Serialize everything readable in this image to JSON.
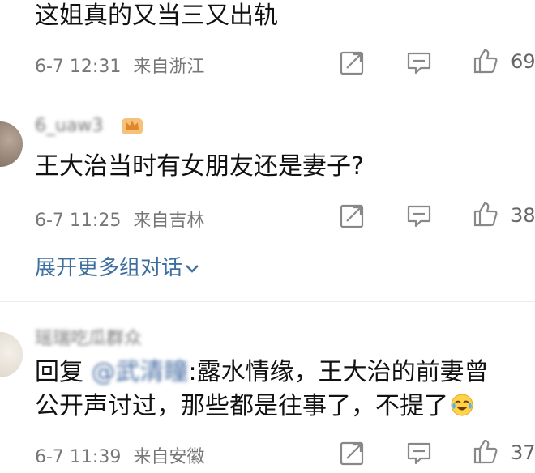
{
  "comments": [
    {
      "text": "这姐真的又当三又出轨",
      "time": "6-7 12:31",
      "location": "来自浙江",
      "likes": "69"
    },
    {
      "username": "6_uaw3",
      "text": "王大治当时有女朋友还是妻子?",
      "time": "6-7 11:25",
      "location": "来自吉林",
      "likes": "38",
      "expand_label": "展开更多组对话"
    },
    {
      "username": "瑶瑞吃瓜群众",
      "reply_prefix": "回复",
      "mention": "@武清瞳",
      "text_line1": ":露水情缘，王大治的前妻曾",
      "text_line2": "公开声讨过，那些都是往事了，不提了",
      "time": "6-7 11:39",
      "location": "来自安徽",
      "likes": "37"
    }
  ],
  "colors": {
    "link": "#3d6f9e",
    "meta": "#777777",
    "badge": "#f0a64a"
  },
  "icons": [
    "share-icon",
    "comment-icon",
    "like-icon",
    "laugh-cry-emoji",
    "crown-badge-icon",
    "chevron-down-icon"
  ]
}
